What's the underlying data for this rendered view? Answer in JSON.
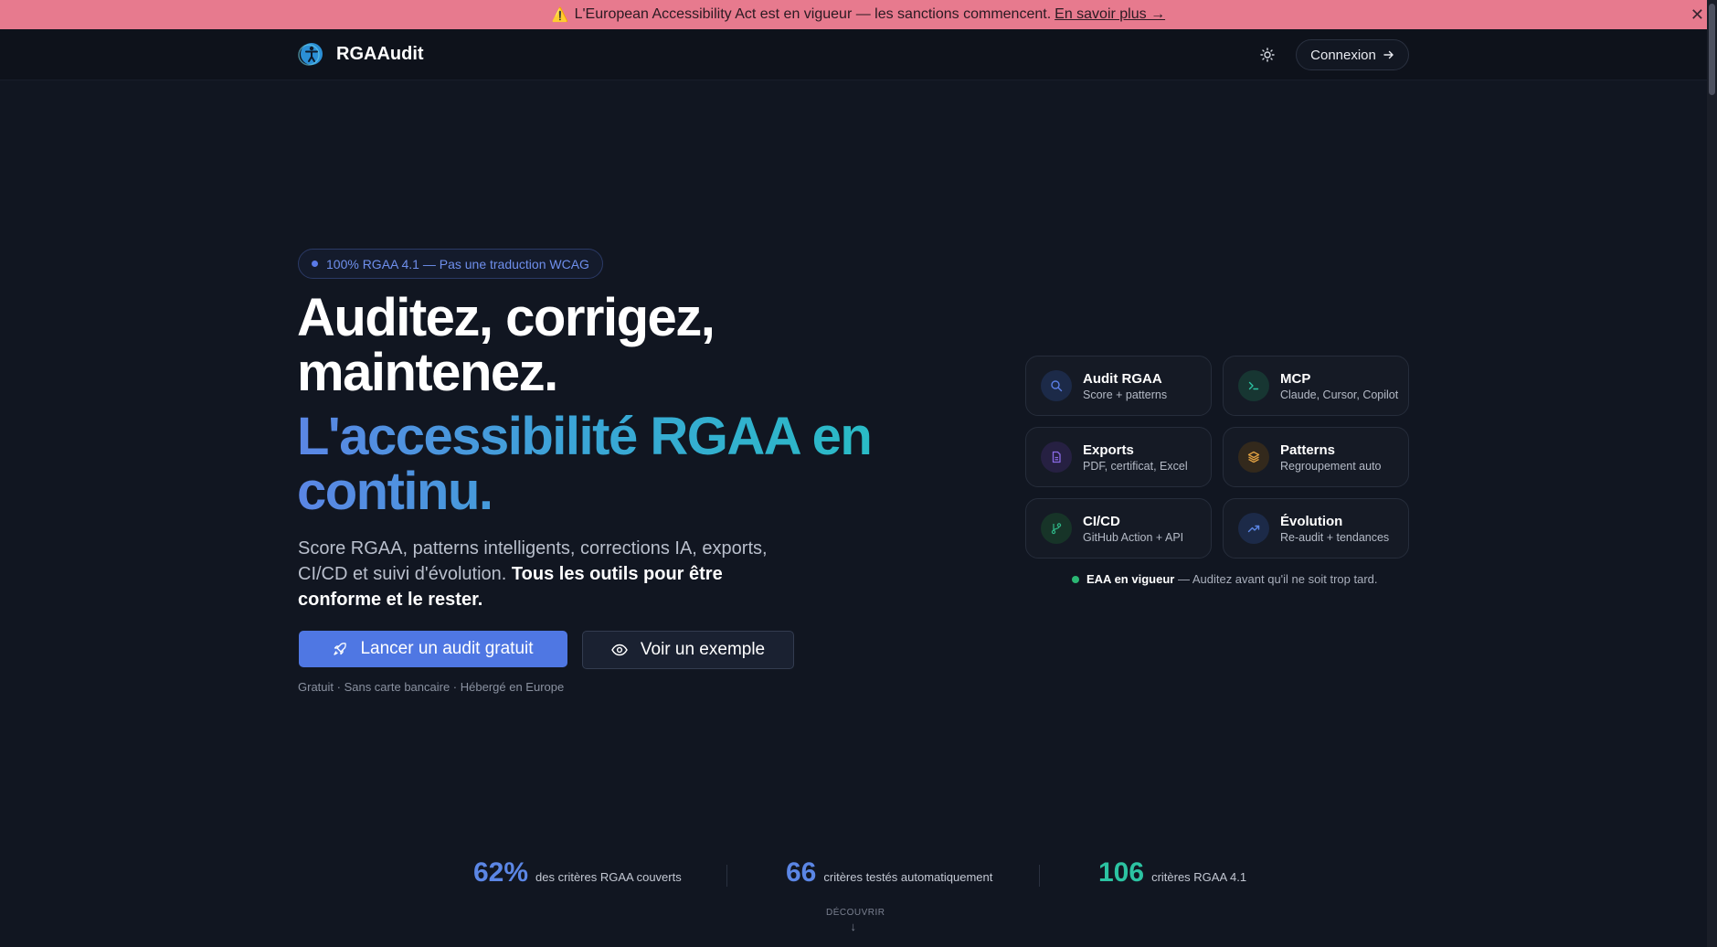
{
  "banner": {
    "warn_icon": "⚠️",
    "text": "L'European Accessibility Act est en vigueur — les sanctions commencent.",
    "link": "En savoir plus →",
    "close": "✕"
  },
  "nav": {
    "brand": "RGAAudit",
    "login_label": "Connexion"
  },
  "hero": {
    "badge": "100% RGAA 4.1 — Pas une traduction WCAG",
    "title_line1": "Auditez, corrigez,",
    "title_line2": "maintenez.",
    "gradient_line1": "L'accessibilité RGAA en",
    "gradient_line2": "continu.",
    "lead_text": "Score RGAA, patterns intelligents, corrections IA, exports, CI/CD et suivi d'évolution. ",
    "lead_bold": "Tous les outils pour être conforme et le rester.",
    "cta_primary": "Lancer un audit gratuit",
    "cta_secondary": "Voir un exemple",
    "fineprint": "Gratuit · Sans carte bancaire · Hébergé en Europe"
  },
  "features": [
    {
      "title": "Audit RGAA",
      "sub": "Score + patterns",
      "icon": "search-icon",
      "color": "#5b7ee5"
    },
    {
      "title": "MCP",
      "sub": "Claude, Cursor, Copilot",
      "icon": "terminal-icon",
      "color": "#2cc3a2"
    },
    {
      "title": "Exports",
      "sub": "PDF, certificat, Excel",
      "icon": "file-icon",
      "color": "#8a6ae6"
    },
    {
      "title": "Patterns",
      "sub": "Regroupement auto",
      "icon": "layers-icon",
      "color": "#e0a042"
    },
    {
      "title": "CI/CD",
      "sub": "GitHub Action + API",
      "icon": "git-branch-icon",
      "color": "#2fb586"
    },
    {
      "title": "Évolution",
      "sub": "Re-audit + tendances",
      "icon": "trend-up-icon",
      "color": "#5b86e5"
    }
  ],
  "eaa": {
    "bold": "EAA en vigueur",
    "text": " — Auditez avant qu'il ne soit trop tard."
  },
  "stats": [
    {
      "value": "62%",
      "label": "des critères RGAA couverts",
      "color": "#5b86e5"
    },
    {
      "value": "66",
      "label": "critères testés automatiquement",
      "color": "#5b86e5"
    },
    {
      "value": "106",
      "label": "critères RGAA 4.1",
      "color": "#2cc3a2"
    }
  ],
  "discover": {
    "label": "DÉCOUVRIR",
    "arrow": "↓"
  }
}
